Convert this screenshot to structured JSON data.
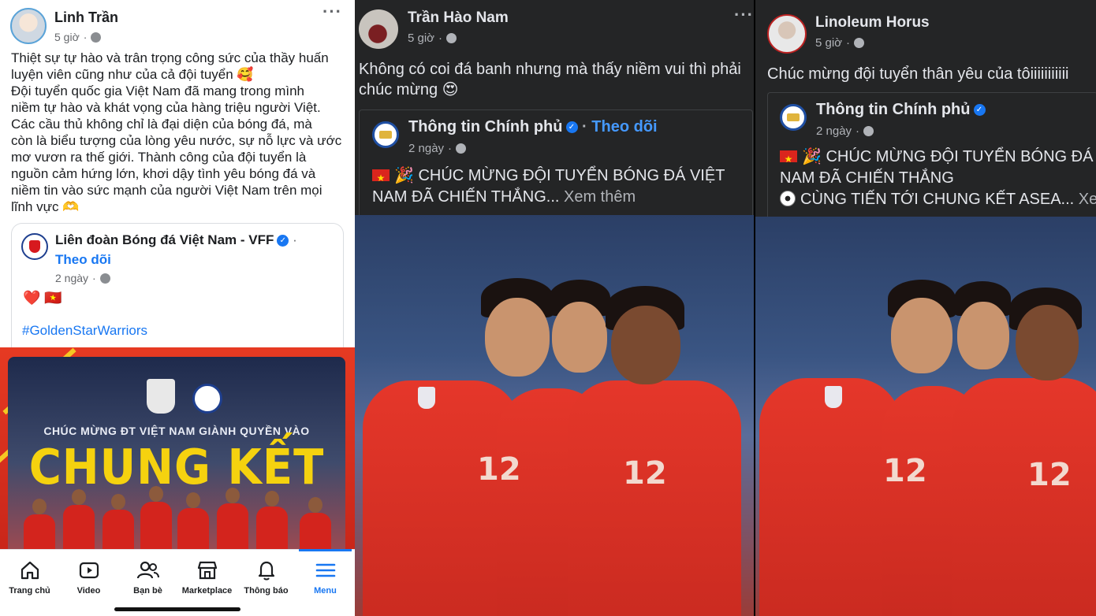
{
  "panel1": {
    "author": "Linh Trần",
    "time": "5 giờ",
    "text_lines": [
      "Thiệt sự tự hào và trân trọng công sức của thầy huấn",
      "luyện viên cũng như của cả đội tuyển 🥰",
      "Đội tuyển quốc gia Việt Nam đã mang trong mình",
      "niềm tự hào và khát vọng của hàng triệu người Việt.",
      "Các cầu thủ không chỉ là đại diện của bóng đá, mà",
      "còn là biểu tượng của lòng yêu nước, sự nỗ lực và ước",
      "mơ vươn ra thế giới. Thành công của đội tuyển là",
      "nguồn cảm hứng lớn, khơi dậy tình yêu bóng đá và",
      "niềm tin vào sức mạnh của người Việt Nam trên mọi",
      "lĩnh vực 🫶"
    ],
    "shared": {
      "page_name": "Liên đoàn Bóng đá Việt Nam - VFF",
      "follow": "Theo dõi",
      "time": "2 ngày",
      "emoji": "❤️ 🇻🇳",
      "hashtag": "#GoldenStarWarriors"
    },
    "promo": {
      "subtitle": "CHÚC MỪNG ĐT VIỆT NAM GIÀNH QUYỀN VÀO",
      "title": "CHUNG KẾT"
    },
    "tabs": [
      {
        "label": "Trang chủ",
        "icon": "home-icon"
      },
      {
        "label": "Video",
        "icon": "video-icon"
      },
      {
        "label": "Bạn bè",
        "icon": "friends-icon"
      },
      {
        "label": "Marketplace",
        "icon": "marketplace-icon"
      },
      {
        "label": "Thông báo",
        "icon": "bell-icon"
      },
      {
        "label": "Menu",
        "icon": "menu-icon"
      }
    ]
  },
  "panel2": {
    "author": "Trần Hào Nam",
    "time": "5 giờ",
    "text_lines": [
      "Không có coi đá banh nhưng mà thấy niềm vui thì phải",
      "chúc mừng 😍"
    ],
    "shared": {
      "page_name": "Thông tin Chính phủ",
      "follow": "Theo dõi",
      "time": "2 ngày",
      "line1": "🎉 CHÚC MỪNG ĐỘI TUYỂN BÓNG ĐÁ VIỆT",
      "line2": "NAM ĐÃ CHIẾN THẮNG...",
      "see_more": "Xem thêm"
    }
  },
  "panel3": {
    "author": "Linoleum Horus",
    "time": "5 giờ",
    "text": "Chúc mừng đội tuyển thân yêu của tôiiiiiiiiiii",
    "shared": {
      "page_name": "Thông tin Chính phủ",
      "time": "2 ngày",
      "line1": "🎉 CHÚC MỪNG ĐỘI TUYỂN BÓNG ĐÁ VI",
      "line2": "NAM ĐÃ CHIẾN THẮNG",
      "line3": "CÙNG TIẾN TỚI CHUNG KẾT ASEA...",
      "see_more": "Xem"
    }
  },
  "jersey_number": "12",
  "colors": {
    "facebook_blue": "#1877f2",
    "dark_bg": "#242526",
    "jersey_red": "#d3241d"
  }
}
